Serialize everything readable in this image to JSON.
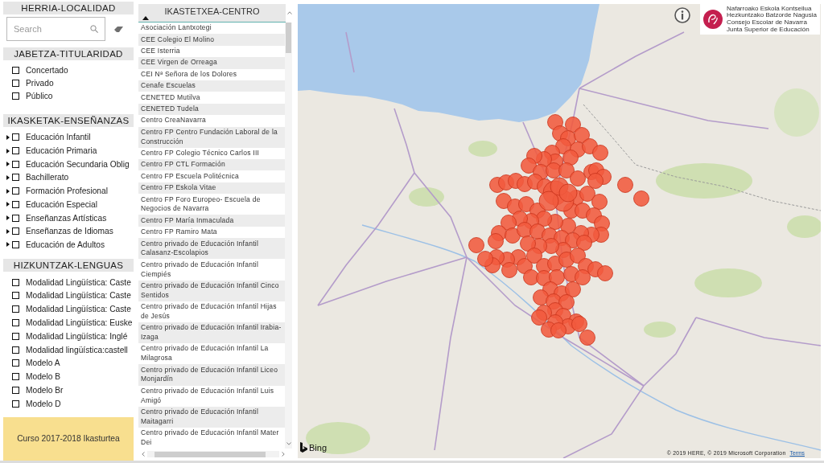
{
  "localidad": {
    "title": "HERRIA-LOCALIDAD",
    "search": {
      "placeholder": "Search"
    }
  },
  "titularidad": {
    "title": "JABETZA-TITULARIDAD",
    "options": [
      {
        "label": "Concertado",
        "checked": false
      },
      {
        "label": "Privado",
        "checked": false
      },
      {
        "label": "Público",
        "checked": false
      }
    ]
  },
  "ensenanzas": {
    "title": "IKASKETAK-ENSEÑANZAS",
    "options": [
      {
        "label": "Educación Infantil",
        "checked": false,
        "expanded": false
      },
      {
        "label": "Educación Primaria",
        "checked": false,
        "expanded": false
      },
      {
        "label": "Educación Secundaria Oblig",
        "checked": false,
        "expanded": false
      },
      {
        "label": "Bachillerato",
        "checked": false,
        "expanded": false
      },
      {
        "label": "Formación Profesional",
        "checked": false,
        "expanded": false
      },
      {
        "label": "Educación Especial",
        "checked": false,
        "expanded": false
      },
      {
        "label": "Enseñanzas Artísticas",
        "checked": false,
        "expanded": false
      },
      {
        "label": "Enseñanzas de Idiomas",
        "checked": false,
        "expanded": false
      },
      {
        "label": "Educación de Adultos",
        "checked": false,
        "expanded": false
      }
    ]
  },
  "lenguas": {
    "title": "HIZKUNTZAK-LENGUAS",
    "options": [
      {
        "label": "Modalidad Lingüística: Caste",
        "checked": false
      },
      {
        "label": "Modalidad Lingüística: Caste",
        "checked": false
      },
      {
        "label": "Modalidad Lingüística: Caste",
        "checked": false
      },
      {
        "label": "Modalidad Lingüística: Euske",
        "checked": false
      },
      {
        "label": "Modalidad Lingüística: Inglé",
        "checked": false
      },
      {
        "label": "Modalidad lingüística:castell",
        "checked": false
      },
      {
        "label": "Modelo A",
        "checked": false
      },
      {
        "label": "Modelo B",
        "checked": false
      },
      {
        "label": "Modelo Br",
        "checked": false
      },
      {
        "label": "Modelo D",
        "checked": false
      }
    ]
  },
  "course": {
    "label": "Curso 2017-2018 Ikasturtea"
  },
  "centros": {
    "title": "IKASTETXEA-CENTRO",
    "sorted_ascending": true,
    "rows": [
      "Asociación Lantxotegi",
      "CEE Colegio El Molino",
      "CEE Isterria",
      "CEE Virgen de Orreaga",
      "CEI Nª Señora de los Dolores",
      "Cenafe Escuelas",
      "CENETED Mutilva",
      "CENETED Tudela",
      "Centro CreaNavarra",
      "Centro FP Centro Fundación Laboral de la Construcción",
      "Centro FP Colegio Técnico Carlos III",
      "Centro FP CTL Formación",
      "Centro FP Escuela Politécnica",
      "Centro FP Eskola Vitae",
      "Centro FP Foro Europeo- Escuela de Negocios de Navarra",
      "Centro FP María Inmaculada",
      "Centro FP Ramiro Mata",
      "Centro privado de Educación Infantil Calasanz-Escolapios",
      "Centro privado de Educación Infantil Ciempiés",
      "Centro privado de Educación Infantil Cinco Sentidos",
      "Centro privado de Educación Infantil Hijas de Jesús",
      "Centro privado de Educación Infantil Irabia-Izaga",
      "Centro privado de Educación Infantil La Milagrosa",
      "Centro privado de Educación Infantil Liceo Monjardín",
      "Centro privado de Educación Infantil Luis Amigó",
      "Centro privado de Educación Infantil Maitagarri",
      "Centro privado de Educación Infantil Mater Dei"
    ]
  },
  "map": {
    "logo_lines": [
      "Nafarroako Eskola Kontseilua",
      "Hezkuntzako Batzorde Nagusia",
      "Consejo Escolar de Navarra",
      "Junta Superior de Educación"
    ],
    "brand": "Bing",
    "copyright": "© 2019 HERE, © 2019 Microsoft Corporation",
    "terms_link": "Terms"
  }
}
